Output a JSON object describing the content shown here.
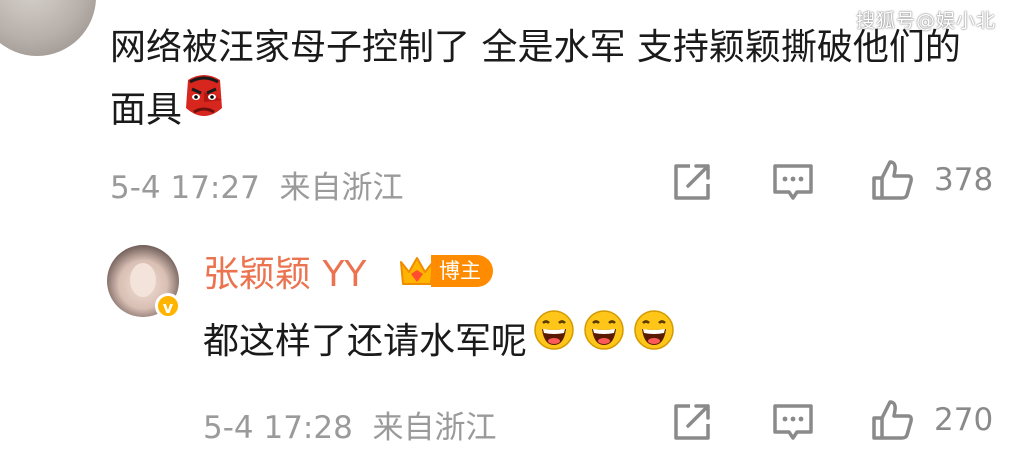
{
  "watermark": "搜狐号@娱小北",
  "comments": [
    {
      "text": "网络被汪家母子控制了 全是水军 支持颖颖撕破他们的面具",
      "emoji": "tengu-mask",
      "date": "5-4 17:27",
      "location": "来自浙江",
      "likes": "378"
    },
    {
      "author": "张颖颖 YY",
      "badge": "博主",
      "text": "都这样了还请水军呢",
      "emoji": "laughing-face",
      "date": "5-4 17:28",
      "location": "来自浙江",
      "likes": "270"
    }
  ],
  "icons": [
    "share-icon",
    "comment-icon",
    "like-icon",
    "verified-badge-icon",
    "crown-icon"
  ],
  "colors": {
    "username": "#eb7350",
    "meta": "#9a9a9a",
    "badge": "#ff8c00",
    "verified": "#ffb400"
  }
}
